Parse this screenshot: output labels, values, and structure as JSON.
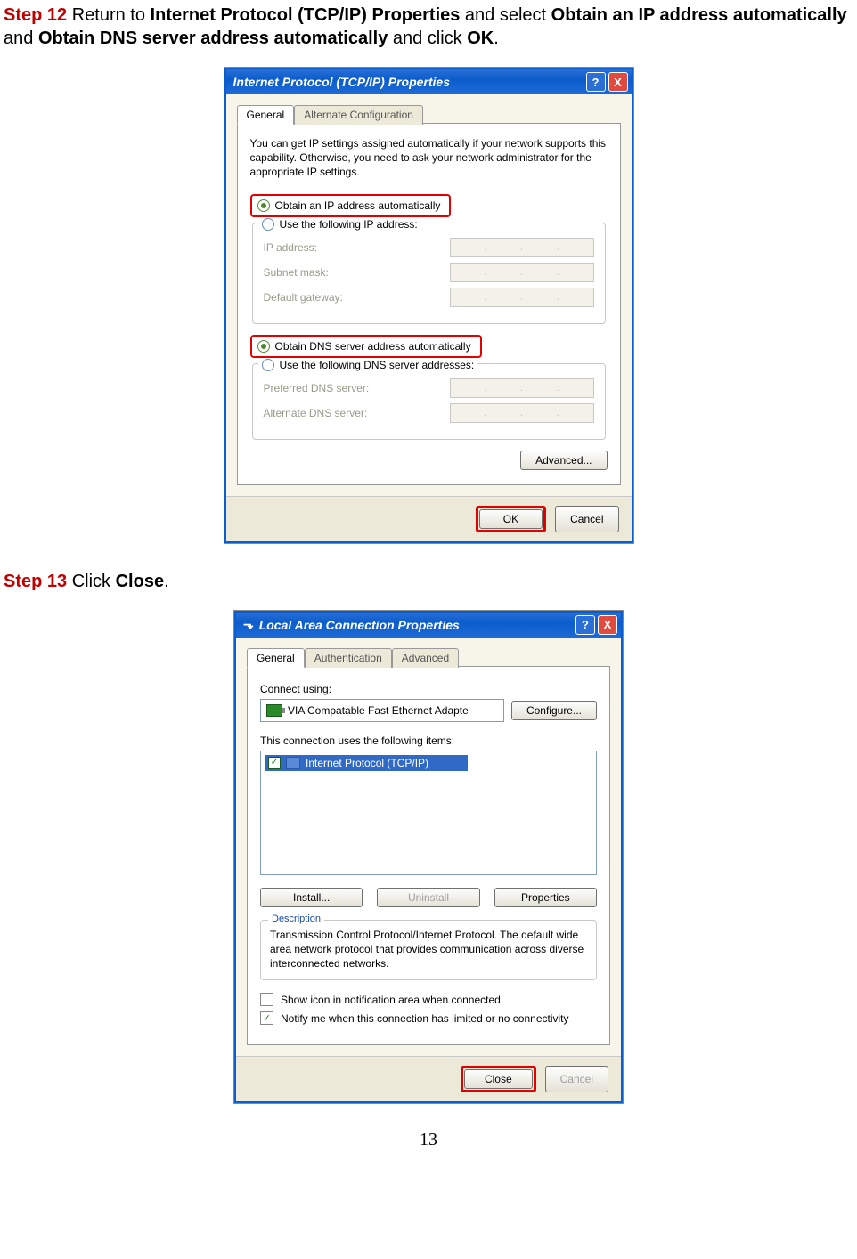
{
  "step12": {
    "label": "Step 12",
    "t1": " Return to ",
    "b1": "Internet Protocol (TCP/IP) Properties",
    "t2": " and select ",
    "b2": "Obtain an IP address automatically",
    "t3": " and ",
    "b3": "Obtain DNS server address automatically",
    "t4": " and click ",
    "b4": "OK",
    "t5": "."
  },
  "step13": {
    "label": "Step 13",
    "t1": " Click ",
    "b1": "Close",
    "t2": "."
  },
  "dlg1": {
    "title": "Internet Protocol (TCP/IP) Properties",
    "tab1": "General",
    "tab2": "Alternate Configuration",
    "desc": "You can get IP settings assigned automatically if your network supports this capability. Otherwise, you need to ask your network administrator for the appropriate IP settings.",
    "r1": "Obtain an IP address automatically",
    "r2": "Use the following IP address:",
    "f1": "IP address:",
    "f2": "Subnet mask:",
    "f3": "Default gateway:",
    "r3": "Obtain DNS server address automatically",
    "r4": "Use the following DNS server addresses:",
    "f4": "Preferred DNS server:",
    "f5": "Alternate DNS server:",
    "adv": "Advanced...",
    "ok": "OK",
    "cancel": "Cancel",
    "help": "?",
    "close": "X"
  },
  "dlg2": {
    "title": "Local Area Connection Properties",
    "tab1": "General",
    "tab2": "Authentication",
    "tab3": "Advanced",
    "connect": "Connect using:",
    "adapter": "VIA Compatable Fast Ethernet Adapte",
    "configure": "Configure...",
    "uses": "This connection uses the following items:",
    "item": "Internet Protocol (TCP/IP)",
    "install": "Install...",
    "uninstall": "Uninstall",
    "properties": "Properties",
    "desc_legend": "Description",
    "desc_text": "Transmission Control Protocol/Internet Protocol. The default wide area network protocol that provides communication across diverse interconnected networks.",
    "chk1": "Show icon in notification area when connected",
    "chk2": "Notify me when this connection has limited or no connectivity",
    "closebtn": "Close",
    "cancel": "Cancel",
    "help": "?",
    "x": "X"
  },
  "pagenum": "13"
}
